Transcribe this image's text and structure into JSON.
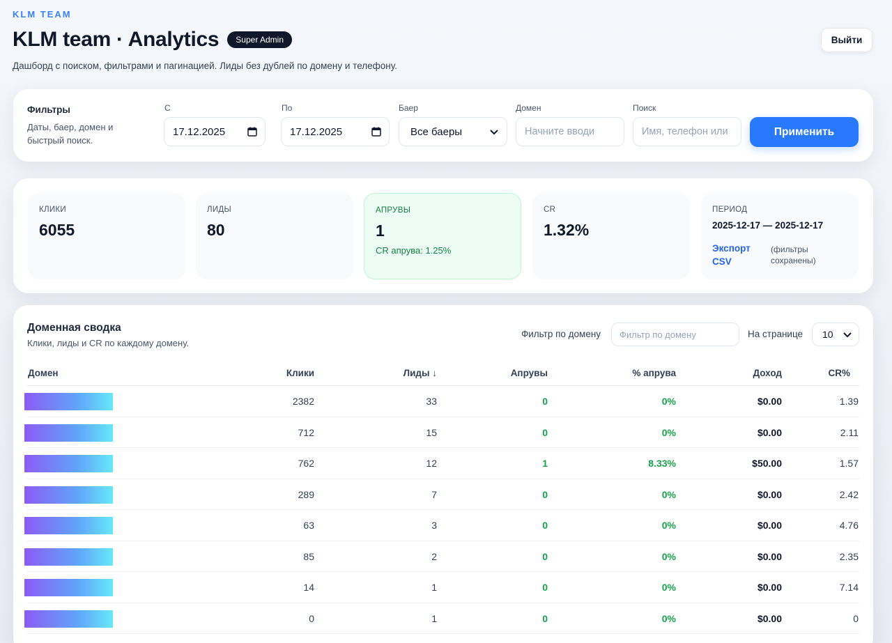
{
  "brand": "KLM TEAM",
  "title": "KLM team · Analytics",
  "role_badge": "Super Admin",
  "subtitle": "Дашборд с поиском, фильтрами и пагинацией. Лиды без дублей по домену и телефону.",
  "logout_label": "Выйти",
  "filters": {
    "heading": "Фильтры",
    "description": "Даты, баер, домен и быстрый поиск.",
    "date_from": {
      "label": "С",
      "value": "17.12.2025"
    },
    "date_to": {
      "label": "По",
      "value": "17.12.2025"
    },
    "buyer": {
      "label": "Баер",
      "value": "Все баеры"
    },
    "domain": {
      "label": "Домен",
      "placeholder": "Начните вводи"
    },
    "search": {
      "label": "Поиск",
      "placeholder": "Имя, телефон или"
    },
    "apply_label": "Применить"
  },
  "stats": {
    "clicks": {
      "label": "КЛИКИ",
      "value": "6055"
    },
    "leads": {
      "label": "ЛИДЫ",
      "value": "80"
    },
    "approves": {
      "label": "АПРУВЫ",
      "value": "1",
      "sub": "CR апрува: 1.25%"
    },
    "cr": {
      "label": "CR",
      "value": "1.32%"
    },
    "period": {
      "label": "ПЕРИОД",
      "value": "2025-12-17 — 2025-12-17",
      "export_label": "Экспорт CSV",
      "export_note": "(фильтры сохранены)"
    }
  },
  "domains": {
    "heading": "Доменная сводка",
    "description": "Клики, лиды и CR по каждому домену.",
    "filter_label": "Фильтр по домену",
    "filter_placeholder": "Фильтр по домену",
    "per_page_label": "На странице",
    "per_page_value": "10",
    "columns": [
      "Домен",
      "Клики",
      "Лиды ↓",
      "Апрувы",
      "% апрува",
      "Доход",
      "CR%"
    ],
    "rows": [
      {
        "clicks": "2382",
        "leads": "33",
        "approves": "0",
        "approve_pct": "0%",
        "income": "$0.00",
        "cr": "1.39"
      },
      {
        "clicks": "712",
        "leads": "15",
        "approves": "0",
        "approve_pct": "0%",
        "income": "$0.00",
        "cr": "2.11"
      },
      {
        "clicks": "762",
        "leads": "12",
        "approves": "1",
        "approve_pct": "8.33%",
        "income": "$50.00",
        "cr": "1.57"
      },
      {
        "clicks": "289",
        "leads": "7",
        "approves": "0",
        "approve_pct": "0%",
        "income": "$0.00",
        "cr": "2.42"
      },
      {
        "clicks": "63",
        "leads": "3",
        "approves": "0",
        "approve_pct": "0%",
        "income": "$0.00",
        "cr": "4.76"
      },
      {
        "clicks": "85",
        "leads": "2",
        "approves": "0",
        "approve_pct": "0%",
        "income": "$0.00",
        "cr": "2.35"
      },
      {
        "clicks": "14",
        "leads": "1",
        "approves": "0",
        "approve_pct": "0%",
        "income": "$0.00",
        "cr": "7.14"
      },
      {
        "clicks": "0",
        "leads": "1",
        "approves": "0",
        "approve_pct": "0%",
        "income": "$0.00",
        "cr": "0"
      }
    ]
  }
}
